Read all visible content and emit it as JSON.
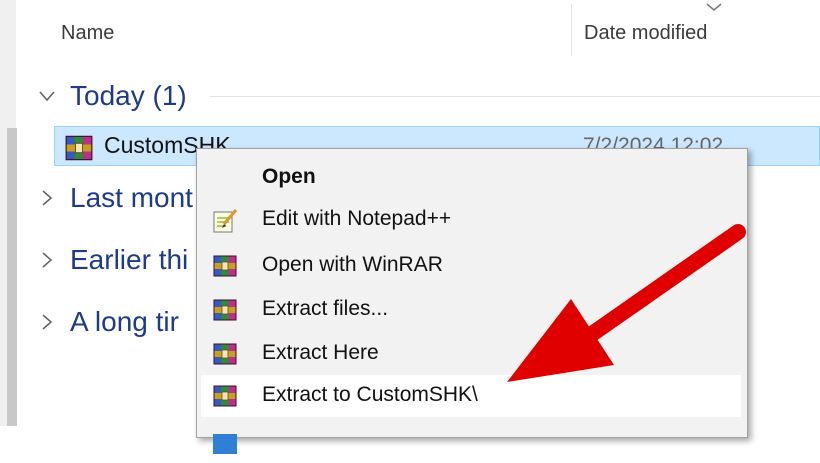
{
  "columns": {
    "name": "Name",
    "date_modified": "Date modified"
  },
  "groups": [
    {
      "label": "Today (1)",
      "expanded": true
    },
    {
      "label": "Last mont",
      "expanded": false
    },
    {
      "label": "Earlier thi",
      "expanded": false
    },
    {
      "label": "A long tir",
      "expanded": false
    }
  ],
  "file": {
    "name": "CustomSHK",
    "date": "7/2/2024 12:02",
    "icon": "winrar-archive-icon"
  },
  "context_menu": {
    "items": [
      {
        "label": "Open",
        "icon": "",
        "bold": true
      },
      {
        "label": "Edit with Notepad++",
        "icon": "notepad-plus-plus-icon"
      },
      {
        "label": "Open with WinRAR",
        "icon": "winrar-icon"
      },
      {
        "label": "Extract files...",
        "icon": "winrar-icon"
      },
      {
        "label": "Extract Here",
        "icon": "winrar-icon"
      },
      {
        "label": "Extract to CustomSHK\\",
        "icon": "winrar-icon",
        "highlighted": true
      }
    ]
  },
  "colors": {
    "accent": "#1e3a8f",
    "selection": "#cce8ff",
    "annotation_arrow": "#e00000"
  }
}
